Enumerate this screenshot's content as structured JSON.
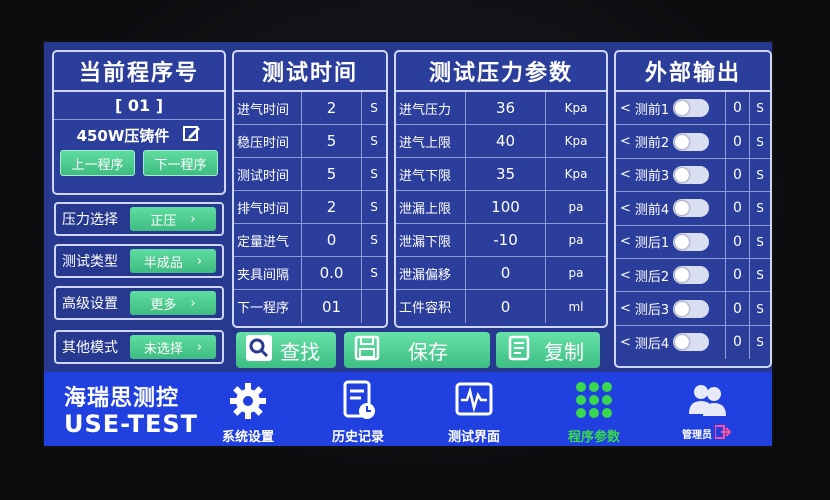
{
  "program": {
    "title": "当前程序号",
    "number": "[ 01 ]",
    "name": "450W压铸件",
    "prev_label": "上一程序",
    "next_label": "下一程序"
  },
  "selectors": [
    {
      "label": "压力选择",
      "value": "正压"
    },
    {
      "label": "测试类型",
      "value": "半成品"
    },
    {
      "label": "高级设置",
      "value": "更多"
    },
    {
      "label": "其他模式",
      "value": "未选择"
    }
  ],
  "test_time": {
    "title": "测试时间",
    "rows": [
      {
        "label": "进气时间",
        "value": "2",
        "unit": "S"
      },
      {
        "label": "稳压时间",
        "value": "5",
        "unit": "S"
      },
      {
        "label": "测试时间",
        "value": "5",
        "unit": "S"
      },
      {
        "label": "排气时间",
        "value": "2",
        "unit": "S"
      },
      {
        "label": "定量进气",
        "value": "0",
        "unit": "S"
      },
      {
        "label": "夹具间隔",
        "value": "0.0",
        "unit": "S"
      },
      {
        "label": "下一程序",
        "value": "01",
        "unit": ""
      }
    ]
  },
  "pressure": {
    "title": "测试压力参数",
    "rows": [
      {
        "label": "进气压力",
        "value": "36",
        "unit": "Kpa"
      },
      {
        "label": "进气上限",
        "value": "40",
        "unit": "Kpa"
      },
      {
        "label": "进气下限",
        "value": "35",
        "unit": "Kpa"
      },
      {
        "label": "泄漏上限",
        "value": "100",
        "unit": "pa"
      },
      {
        "label": "泄漏下限",
        "value": "-10",
        "unit": "pa"
      },
      {
        "label": "泄漏偏移",
        "value": "0",
        "unit": "pa"
      },
      {
        "label": "工件容积",
        "value": "0",
        "unit": "ml"
      }
    ]
  },
  "output": {
    "title": "外部输出",
    "rows": [
      {
        "label": "测前1",
        "value": "0",
        "unit": "S"
      },
      {
        "label": "测前2",
        "value": "0",
        "unit": "S"
      },
      {
        "label": "测前3",
        "value": "0",
        "unit": "S"
      },
      {
        "label": "测前4",
        "value": "0",
        "unit": "S"
      },
      {
        "label": "测后1",
        "value": "0",
        "unit": "S"
      },
      {
        "label": "测后2",
        "value": "0",
        "unit": "S"
      },
      {
        "label": "测后3",
        "value": "0",
        "unit": "S"
      },
      {
        "label": "测后4",
        "value": "0",
        "unit": "S"
      }
    ]
  },
  "actions": {
    "search": "查找",
    "save": "保存",
    "copy": "复制"
  },
  "brand": {
    "line1": "海瑞思测控",
    "line2": "USE-TEST"
  },
  "nav": {
    "system": "系统设置",
    "history": "历史记录",
    "test": "测试界面",
    "program": "程序参数",
    "admin": "管理员"
  },
  "colors": {
    "screen_bg": "#27398f",
    "bar_bg": "#2040e0",
    "accent_green": "#46c48a",
    "active_nav": "#39d84f"
  }
}
